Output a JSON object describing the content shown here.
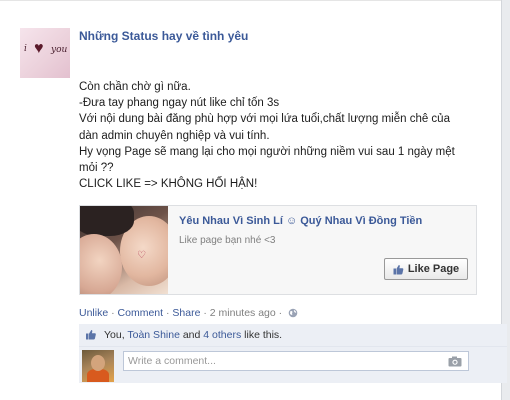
{
  "page": {
    "name": "Những Status hay về tình yêu",
    "avatar_text_left": "i",
    "avatar_text_right": "you"
  },
  "post": {
    "lines": [
      "Còn chần chờ gì nữa.",
      "-Đưa tay phang ngay nút like chỉ tốn 3s",
      "Với nội dung bài đăng phù hợp với mọi lứa tuổi,chất lượng miễn chê của",
      "dàn admin chuyên nghiệp và vui tính.",
      "Hy vọng Page sẽ mang lại cho mọi người những niềm vui sau 1 ngày mệt",
      "mỏi ??",
      "CLICK LIKE => KHÔNG HỐI HẬN!"
    ]
  },
  "share": {
    "title": "Yêu Nhau Vì Sinh Lí ☺ Quý Nhau Vì Đồng Tiền",
    "subtitle": "Like page bạn nhé <3",
    "like_button": "Like Page"
  },
  "actions": {
    "unlike": "Unlike",
    "sep": " · ",
    "comment": "Comment",
    "share": "Share",
    "time": "2 minutes ago",
    "sep2": " · "
  },
  "likes": {
    "you": "You, ",
    "friend": "Toàn Shine",
    "and": " and ",
    "others": "4 others",
    "suffix": " like this."
  },
  "comment": {
    "placeholder": "Write a comment..."
  },
  "icons": [
    "heart-icon",
    "thumbs-up-icon",
    "globe-icon",
    "camera-icon"
  ],
  "colors": {
    "link": "#3b5998",
    "bar": "#eceff5",
    "muted": "#808080"
  }
}
